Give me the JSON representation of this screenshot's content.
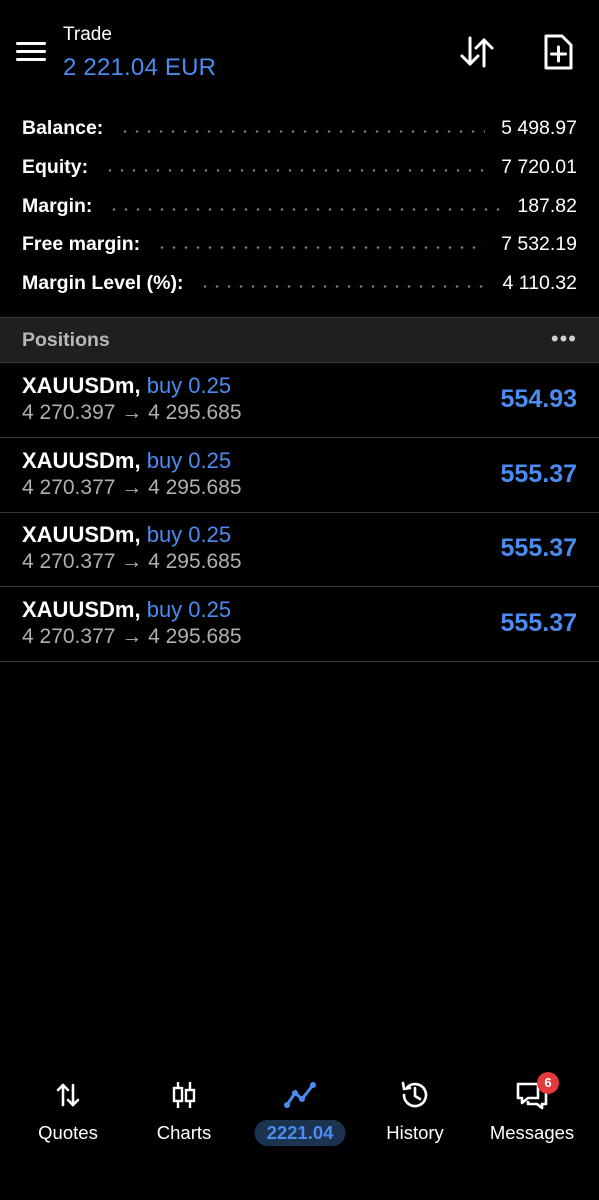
{
  "header": {
    "title": "Trade",
    "subtitle": "2 221.04 EUR",
    "icons": [
      "menu-icon",
      "sort-icon",
      "new-order-icon"
    ]
  },
  "summary": [
    {
      "label": "Balance:",
      "value": "5 498.97"
    },
    {
      "label": "Equity:",
      "value": "7 720.01"
    },
    {
      "label": "Margin:",
      "value": "187.82"
    },
    {
      "label": "Free margin:",
      "value": "7 532.19"
    },
    {
      "label": "Margin Level (%):",
      "value": "4 110.32"
    }
  ],
  "positions": {
    "title": "Positions",
    "more_label": "•••",
    "items": [
      {
        "symbol": "XAUUSDm,",
        "side": "buy 0.25",
        "prices": "4 270.397 → 4 295.685",
        "profit": "554.93"
      },
      {
        "symbol": "XAUUSDm,",
        "side": "buy 0.25",
        "prices": "4 270.377 → 4 295.685",
        "profit": "555.37"
      },
      {
        "symbol": "XAUUSDm,",
        "side": "buy 0.25",
        "prices": "4 270.377 → 4 295.685",
        "profit": "555.37"
      },
      {
        "symbol": "XAUUSDm,",
        "side": "buy 0.25",
        "prices": "4 270.377 → 4 295.685",
        "profit": "555.37"
      }
    ]
  },
  "tabs": [
    {
      "label": "Quotes",
      "icon": "quotes-icon"
    },
    {
      "label": "Charts",
      "icon": "charts-icon"
    },
    {
      "label": "2221.04",
      "icon": "trade-icon",
      "active": true
    },
    {
      "label": "History",
      "icon": "history-icon"
    },
    {
      "label": "Messages",
      "icon": "messages-icon",
      "badge": "6"
    }
  ],
  "colors": {
    "accent": "#4a8cf0",
    "background": "#000000",
    "badge": "#e33b3b"
  }
}
